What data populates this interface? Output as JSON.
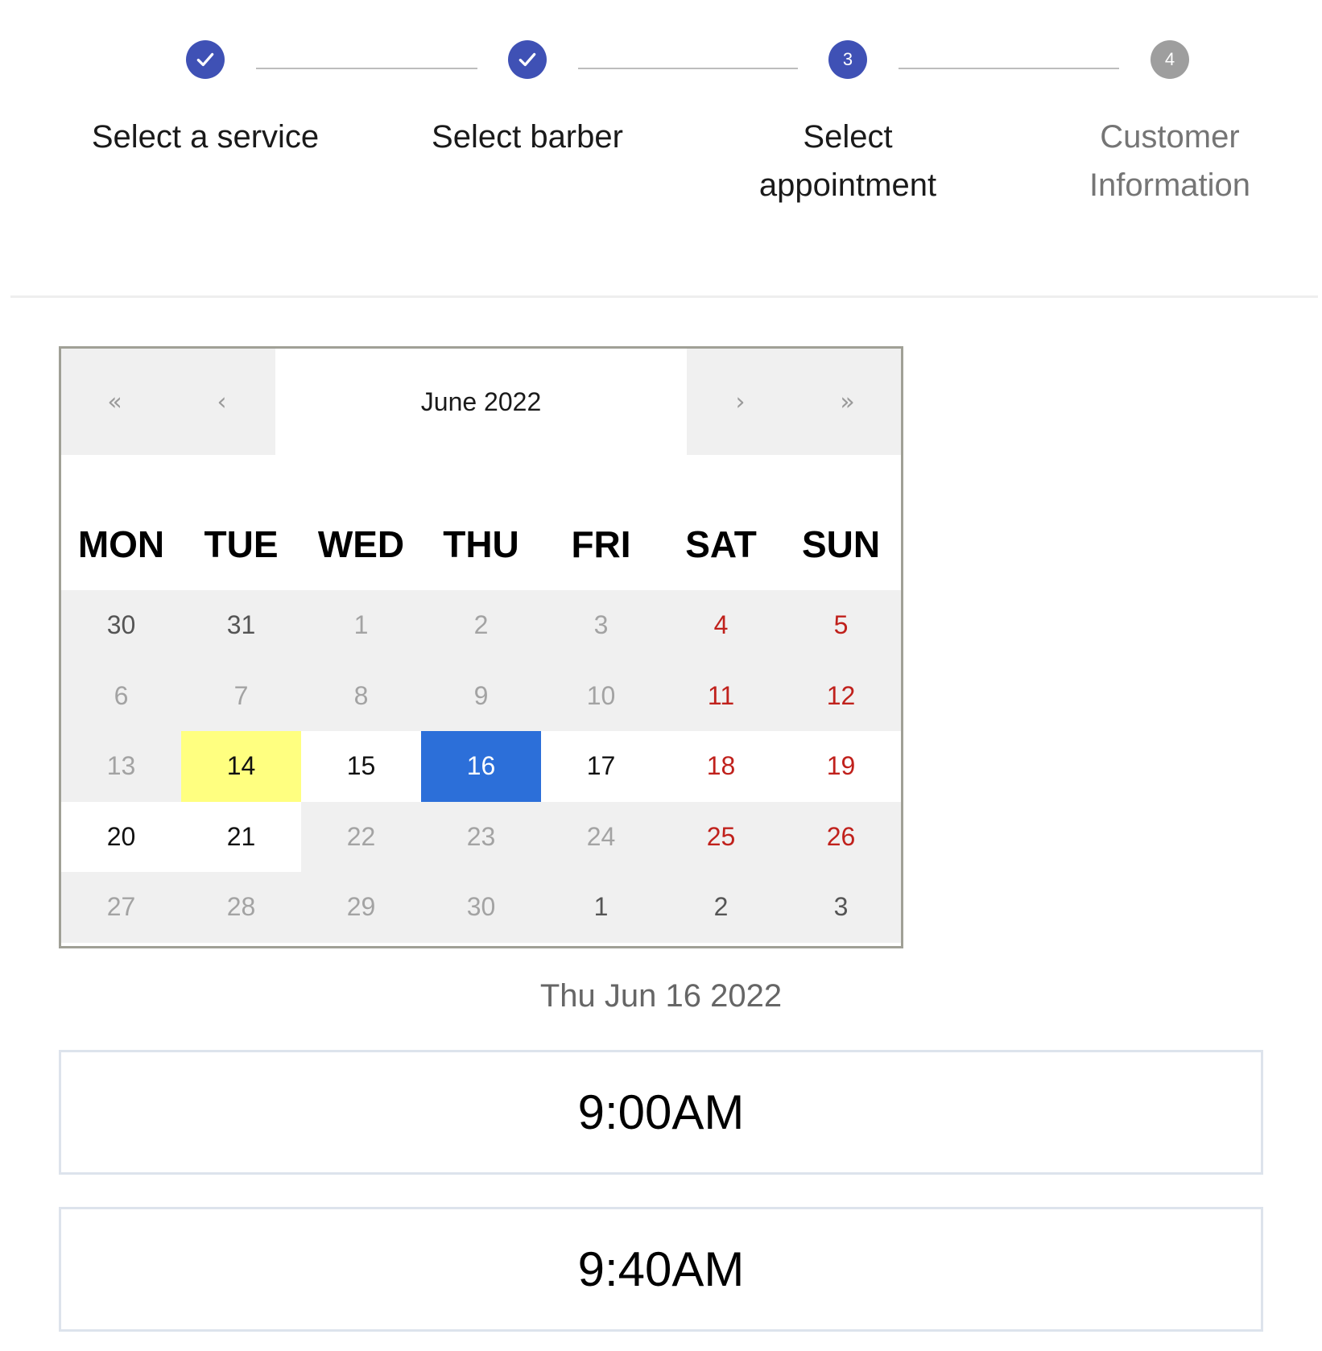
{
  "stepper": {
    "steps": [
      {
        "label": "Select a service",
        "state": "completed",
        "icon": "check-icon"
      },
      {
        "label": "Select barber",
        "state": "completed",
        "icon": "check-icon"
      },
      {
        "label": "Select\nappointment",
        "state": "active",
        "number": "3"
      },
      {
        "label": "Customer\nInformation",
        "state": "upcoming",
        "number": "4"
      }
    ]
  },
  "calendar": {
    "month_label": "June 2022",
    "nav": {
      "prev_year": "«",
      "prev_month": "‹",
      "next_month": "›",
      "next_year": "»"
    },
    "weekdays": [
      "MON",
      "TUE",
      "WED",
      "THU",
      "FRI",
      "SAT",
      "SUN"
    ],
    "weeks": [
      [
        {
          "label": "30",
          "state": "other-month"
        },
        {
          "label": "31",
          "state": "other-month"
        },
        {
          "label": "1",
          "state": "disabled"
        },
        {
          "label": "2",
          "state": "disabled"
        },
        {
          "label": "3",
          "state": "disabled"
        },
        {
          "label": "4",
          "state": "weekend"
        },
        {
          "label": "5",
          "state": "weekend"
        }
      ],
      [
        {
          "label": "6",
          "state": "disabled"
        },
        {
          "label": "7",
          "state": "disabled"
        },
        {
          "label": "8",
          "state": "disabled"
        },
        {
          "label": "9",
          "state": "disabled"
        },
        {
          "label": "10",
          "state": "disabled"
        },
        {
          "label": "11",
          "state": "weekend"
        },
        {
          "label": "12",
          "state": "weekend"
        }
      ],
      [
        {
          "label": "13",
          "state": "disabled"
        },
        {
          "label": "14",
          "state": "today"
        },
        {
          "label": "15",
          "state": "available"
        },
        {
          "label": "16",
          "state": "selected"
        },
        {
          "label": "17",
          "state": "available"
        },
        {
          "label": "18",
          "state": "available-weekend"
        },
        {
          "label": "19",
          "state": "available-weekend"
        }
      ],
      [
        {
          "label": "20",
          "state": "available"
        },
        {
          "label": "21",
          "state": "available"
        },
        {
          "label": "22",
          "state": "disabled"
        },
        {
          "label": "23",
          "state": "disabled"
        },
        {
          "label": "24",
          "state": "disabled"
        },
        {
          "label": "25",
          "state": "weekend"
        },
        {
          "label": "26",
          "state": "weekend"
        }
      ],
      [
        {
          "label": "27",
          "state": "disabled"
        },
        {
          "label": "28",
          "state": "disabled"
        },
        {
          "label": "29",
          "state": "disabled"
        },
        {
          "label": "30",
          "state": "disabled"
        },
        {
          "label": "1",
          "state": "other-month"
        },
        {
          "label": "2",
          "state": "other-month"
        },
        {
          "label": "3",
          "state": "other-month"
        }
      ]
    ],
    "colors": {
      "selected": "#2c6fd9",
      "today": "#ffff80",
      "weekend": "#c0211c",
      "stepper_active": "#3f51b5",
      "stepper_inactive": "#9e9e9e"
    }
  },
  "selected_date": "Thu Jun 16 2022",
  "time_slots": [
    "9:00AM",
    "9:40AM"
  ]
}
